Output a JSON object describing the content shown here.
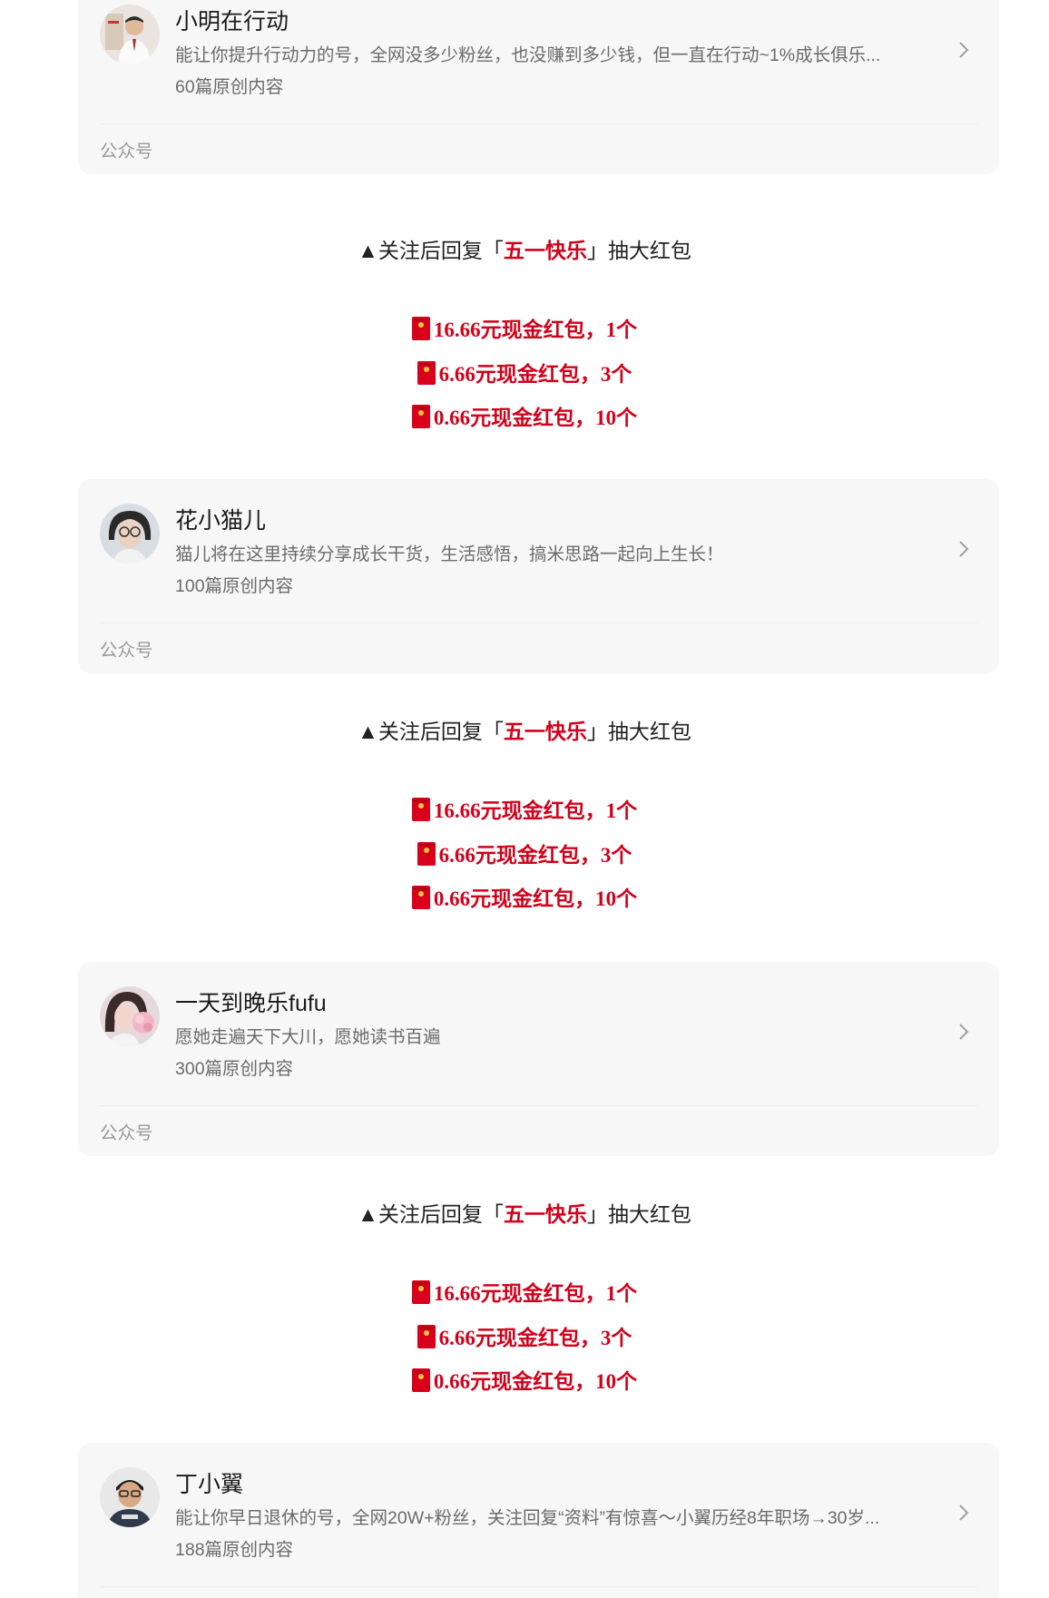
{
  "accounts": [
    {
      "name": "小明在行动",
      "description": "能让你提升行动力的号，全网没多少粉丝，也没赚到多少钱，但一直在行动~1%成长俱乐...",
      "count": "60篇原创内容",
      "type": "公众号",
      "avatar_icon": "man-portrait-avatar"
    },
    {
      "name": "花小猫儿",
      "description": "猫儿将在这里持续分享成长干货，生活感悟，搞米思路一起向上生长！",
      "count": "100篇原创内容",
      "type": "公众号",
      "avatar_icon": "woman-glasses-avatar"
    },
    {
      "name": "一天到晚乐fufu",
      "description": "愿她走遍天下大川，愿她读书百遍",
      "count": "300篇原创内容",
      "type": "公众号",
      "avatar_icon": "woman-flowers-avatar"
    },
    {
      "name": "丁小翼",
      "description": "能让你早日退休的号，全网20W+粉丝，关注回复“资料”有惊喜～小翼历经8年职场→30岁...",
      "count": "188篇原创内容",
      "avatar_icon": "man-glasses-avatar"
    }
  ],
  "promo": {
    "prefix": "▲关注后回复「",
    "keyword": "五一快乐",
    "suffix": "」抽大红包",
    "rewards": [
      "16.66元现金红包，1个",
      "6.66元现金红包，3个",
      "0.66元现金红包，10个"
    ]
  },
  "colors": {
    "highlight": "#d0021b",
    "card_bg": "#f7f7f7"
  }
}
